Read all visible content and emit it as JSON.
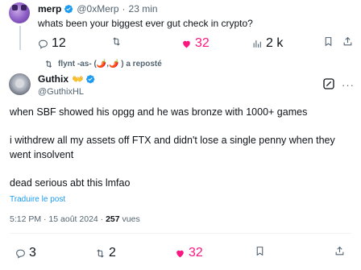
{
  "quoted": {
    "name": "merp",
    "handle": "@0xMerp",
    "separator": "·",
    "time": "23 min",
    "text": "whats been your biggest ever gut check in crypto?",
    "replies": "12",
    "likes": "32",
    "views": "2 k"
  },
  "repost_note": "flynt -as- (🌶️,🌶️ ) a reposté",
  "main": {
    "name": "Guthix",
    "badge": "👐",
    "handle": "@GuthixHL",
    "line1": "when SBF showed his opgg and he was bronze with 1000+ games",
    "line2": "i withdrew all my assets off FTX and didn't lose a single penny when they",
    "line3": "went insolvent",
    "line4": "dead serious abt this lmfao",
    "translate": "Traduire le post",
    "timestamp": "5:12 PM · 15 août 2024 ·",
    "views_count": "257",
    "views_label": "vues",
    "replies": "3",
    "reposts": "2",
    "likes": "32"
  },
  "colors": {
    "like": "#f91880",
    "link": "#1d9bf0",
    "muted": "#536471"
  }
}
